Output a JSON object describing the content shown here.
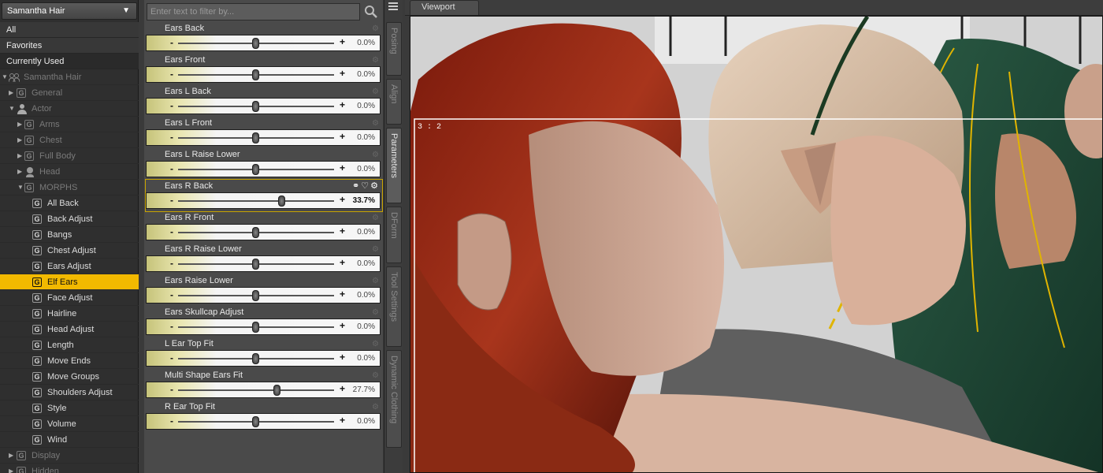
{
  "node_selector": {
    "value": "Samantha Hair"
  },
  "filters": [
    "All",
    "Favorites",
    "Currently Used"
  ],
  "tree": {
    "root": "Samantha Hair",
    "general": "General",
    "actor": "Actor",
    "arms": "Arms",
    "chest": "Chest",
    "full_body": "Full Body",
    "head": "Head",
    "morphs": "MORPHS",
    "morph_items": [
      "All Back",
      "Back Adjust",
      "Bangs",
      "Chest Adjust",
      "Ears Adjust",
      "Elf Ears",
      "Face Adjust",
      "Hairline",
      "Head Adjust",
      "Length",
      "Move Ends",
      "Move Groups",
      "Shoulders Adjust",
      "Style",
      "Volume",
      "Wind"
    ],
    "selected": "Elf Ears",
    "display": "Display",
    "hidden": "Hidden"
  },
  "search": {
    "placeholder": "Enter text to filter by..."
  },
  "sliders": [
    {
      "name": "Ears Back",
      "value": "0.0%",
      "level": 0.0
    },
    {
      "name": "Ears Front",
      "value": "0.0%",
      "level": 0.0
    },
    {
      "name": "Ears L Back",
      "value": "0.0%",
      "level": 0.0
    },
    {
      "name": "Ears L Front",
      "value": "0.0%",
      "level": 0.0
    },
    {
      "name": "Ears L Raise Lower",
      "value": "0.0%",
      "level": 0.0
    },
    {
      "name": "Ears R Back",
      "value": "33.7%",
      "level": 0.337,
      "active": true
    },
    {
      "name": "Ears R Front",
      "value": "0.0%",
      "level": 0.0
    },
    {
      "name": "Ears R Raise Lower",
      "value": "0.0%",
      "level": 0.0
    },
    {
      "name": "Ears Raise Lower",
      "value": "0.0%",
      "level": 0.0
    },
    {
      "name": "Ears Skullcap Adjust",
      "value": "0.0%",
      "level": 0.0
    },
    {
      "name": "L Ear Top Fit",
      "value": "0.0%",
      "level": 0.0
    },
    {
      "name": "Multi Shape Ears Fit",
      "value": "27.7%",
      "level": 0.277
    },
    {
      "name": "R Ear Top Fit",
      "value": "0.0%",
      "level": 0.0
    }
  ],
  "slider_signs": {
    "minus": "-",
    "plus": "+"
  },
  "vertical_tabs": [
    "Posing",
    "Align",
    "Parameters",
    "DForm",
    "Tool Settings",
    "Dynamic Clothing"
  ],
  "active_tab": "Parameters",
  "viewport": {
    "tab": "Viewport",
    "aspect_label": "3 : 2"
  },
  "colors": {
    "selection": "#f2b900",
    "slider_gradient_start": "#c6c37a"
  }
}
